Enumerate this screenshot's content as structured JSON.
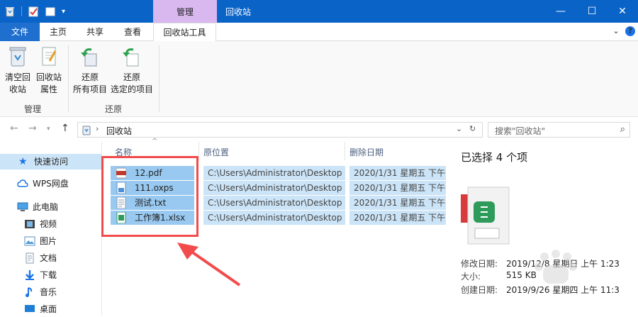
{
  "window": {
    "context_tab": "管理",
    "title": "回收站",
    "controls": [
      "—",
      "☐",
      "✕"
    ]
  },
  "ribbon_tabs": {
    "file": "文件",
    "home": "主页",
    "share": "共享",
    "view": "查看",
    "tools": "回收站工具"
  },
  "ribbon": {
    "empty_bin_line1": "清空回",
    "empty_bin_line2": "收站",
    "props_line1": "回收站",
    "props_line2": "属性",
    "restore_all_line1": "还原",
    "restore_all_line2": "所有项目",
    "restore_sel_line1": "还原",
    "restore_sel_line2": "选定的项目",
    "group_manage": "管理",
    "group_restore": "还原"
  },
  "address": {
    "crumb": "回收站",
    "search_placeholder": "搜索\"回收站\""
  },
  "nav": {
    "quick_access": "快速访问",
    "wps": "WPS网盘",
    "this_pc": "此电脑",
    "videos": "视频",
    "pictures": "图片",
    "documents": "文档",
    "downloads": "下载",
    "music": "音乐",
    "desktop": "桌面"
  },
  "columns": {
    "name": "名称",
    "original_location": "原位置",
    "date_deleted": "删除日期"
  },
  "files": [
    {
      "name": "12.pdf",
      "location": "C:\\Users\\Administrator\\Desktop",
      "deleted": "2020/1/31 星期五 下午"
    },
    {
      "name": "111.oxps",
      "location": "C:\\Users\\Administrator\\Desktop",
      "deleted": "2020/1/31 星期五 下午"
    },
    {
      "name": "测试.txt",
      "location": "C:\\Users\\Administrator\\Desktop",
      "deleted": "2020/1/31 星期五 下午"
    },
    {
      "name": "工作簿1.xlsx",
      "location": "C:\\Users\\Administrator\\Desktop",
      "deleted": "2020/1/31 星期五 下午"
    }
  ],
  "details": {
    "heading": "已选择 4 个项",
    "modified_label": "修改日期:",
    "modified_value": "2019/12/8 星期日 上午 1:23",
    "size_label": "大小:",
    "size_value": "515 KB",
    "created_label": "创建日期:",
    "created_value": "2019/9/26 星期四 上午 11:3"
  },
  "colors": {
    "titlebar": "#0a64c8",
    "context_tab": "#d9b8ef",
    "selection": "#cce4f7",
    "highlight_box": "#f24b4b"
  }
}
